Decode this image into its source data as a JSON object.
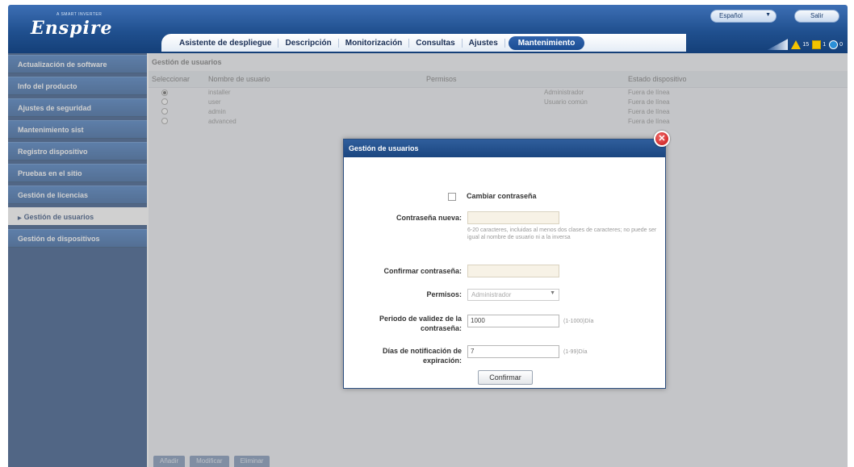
{
  "header": {
    "logo": "Enspire",
    "logo_sub": "A smart inverter",
    "language": "Español",
    "logout_label": "Salir",
    "tabs": [
      {
        "label": "Asistente de despliegue",
        "active": false
      },
      {
        "label": "Descripción",
        "active": false
      },
      {
        "label": "Monitorización",
        "active": false
      },
      {
        "label": "Consultas",
        "active": false
      },
      {
        "label": "Ajustes",
        "active": false
      },
      {
        "label": "Mantenimiento",
        "active": true
      }
    ],
    "status": {
      "warn_count": "15",
      "square_count": "1",
      "circle_count": "0"
    }
  },
  "sidebar": {
    "items": [
      {
        "label": "Actualización de software",
        "active": false
      },
      {
        "label": "Info del producto",
        "active": false
      },
      {
        "label": "Ajustes de seguridad",
        "active": false
      },
      {
        "label": "Mantenimiento sist",
        "active": false
      },
      {
        "label": "Registro dispositivo",
        "active": false
      },
      {
        "label": "Pruebas en el sitio",
        "active": false
      },
      {
        "label": "Gestión de licencias",
        "active": false
      },
      {
        "label": "Gestión de usuarios",
        "active": true
      },
      {
        "label": "Gestión de dispositivos",
        "active": false
      }
    ]
  },
  "main": {
    "title": "Gestión de usuarios",
    "table": {
      "headers": [
        "Seleccionar",
        "Nombre de usuario",
        "Permisos",
        "Estado dispositivo"
      ],
      "rows": [
        {
          "selected": true,
          "user": "installer",
          "role": "Administrador",
          "status": "Fuera de línea"
        },
        {
          "selected": false,
          "user": "user",
          "role": "Usuario común",
          "status": "Fuera de línea"
        },
        {
          "selected": false,
          "user": "admin",
          "role": "",
          "status": "Fuera de línea"
        },
        {
          "selected": false,
          "user": "advanced",
          "role": "",
          "status": "Fuera de línea"
        }
      ]
    },
    "bottom_buttons": [
      "Añadir",
      "Modificar",
      "Eliminar"
    ]
  },
  "dialog": {
    "title": "Gestión de usuarios",
    "change_password_label": "Cambiar contraseña",
    "new_password_label": "Contraseña nueva:",
    "new_password_hint": "6-20 caracteres, incluidas al menos dos clases de caracteres; no puede ser igual al nombre de usuario ni a la inversa",
    "confirm_password_label": "Confirmar contraseña:",
    "role_label": "Permisos:",
    "role_value": "Administrador",
    "validity_label": "Periodo de validez de la contraseña:",
    "validity_value": "1000",
    "validity_hint": "(1-1000)Día",
    "expiry_label": "Días de notificación de expiración:",
    "expiry_value": "7",
    "expiry_hint": "(1-99)Día",
    "confirm_button": "Confirmar"
  }
}
